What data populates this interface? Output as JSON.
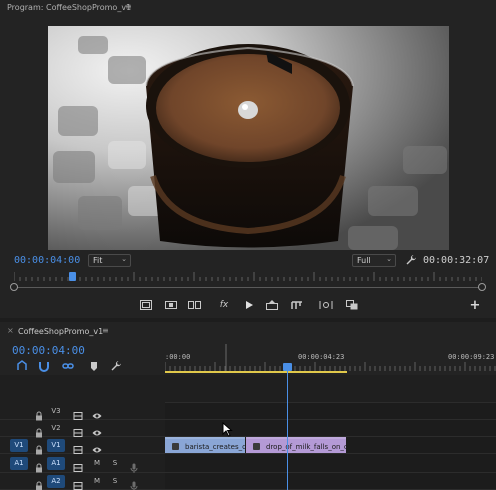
{
  "program_monitor": {
    "title": "Program: CoffeeShopPromo_v1",
    "menu_icon": "hamburger-icon",
    "current_timecode": "00:00:04:00",
    "zoom_value": "Fit",
    "resolution_value": "Full",
    "duration_timecode": "00:00:32:07",
    "playhead_fraction": 0.124
  },
  "transport": {
    "buttons": [
      "safe-margins-icon",
      "insert-icon",
      "export-frame-icon",
      "fx-icon",
      "play-icon",
      "lift-icon",
      "extract-icon",
      "vr-icon",
      "compare-icon",
      "add-icon"
    ]
  },
  "timeline": {
    "sequence_name": "CoffeeShopPromo_v1",
    "close_glyph": "×",
    "menu_glyph": "≡",
    "current_timecode": "00:00:04:00",
    "ruler_labels": [
      ":00:00",
      "00:00:04:23",
      "00:00:09:23"
    ],
    "tracks": [
      {
        "id": "V3",
        "source": "",
        "type": "video"
      },
      {
        "id": "V2",
        "source": "",
        "type": "video"
      },
      {
        "id": "V1",
        "source": "V1",
        "type": "video"
      },
      {
        "id": "A1",
        "source": "A1",
        "type": "audio",
        "m": "M",
        "s": "S"
      },
      {
        "id": "A2",
        "source": "",
        "type": "audio",
        "m": "M",
        "s": "S"
      }
    ],
    "clips": [
      {
        "name": "barista_creates_coff",
        "color": "#8aa6d6"
      },
      {
        "name": "drop_of_milk_falls_on_cof",
        "color": "#b49ad6"
      }
    ]
  },
  "colors": {
    "accent": "#4a8fe6",
    "workarea": "#e0c84a",
    "clip_blue": "#8aa6d6",
    "clip_purple": "#b49ad6"
  }
}
